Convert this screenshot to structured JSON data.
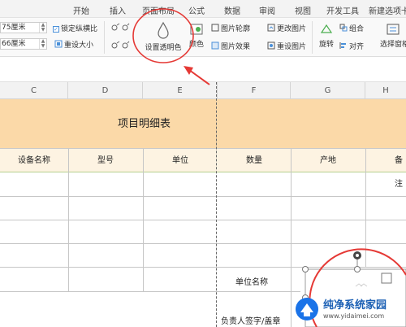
{
  "ribbon_tabs": [
    "开始",
    "插入",
    "页面布局",
    "公式",
    "数据",
    "审阅",
    "视图",
    "开发工具",
    "新建选项卡"
  ],
  "toolbar": {
    "width_value": "75厘米",
    "height_value": "66厘米",
    "lock_ratio_label": "锁定纵横比",
    "reset_size_label": "重设大小",
    "set_transparent_label": "设置透明色",
    "color_label": "颜色",
    "picture_outline_label": "图片轮廓",
    "picture_effect_label": "图片效果",
    "change_picture_label": "更改图片",
    "reset_picture_label": "重设图片",
    "rotate_label": "旋转",
    "group_label": "组合",
    "align_label": "对齐",
    "selection_pane_label": "选择窗格"
  },
  "columns": [
    "C",
    "D",
    "E",
    "F",
    "G",
    "H"
  ],
  "sheet": {
    "title": "项目明细表",
    "headers": [
      "设备名称",
      "型号",
      "单位",
      "数量",
      "产地",
      "备注"
    ],
    "unit_name_label": "单位名称",
    "signer_label": "负责人签字/盖章"
  },
  "watermark": {
    "text": "纯净系统家园",
    "url": "www.yidaimei.com"
  },
  "colors": {
    "title_fill": "#fbd9a8",
    "header_fill": "#fdf3e2",
    "annotation_red": "#e53935"
  }
}
